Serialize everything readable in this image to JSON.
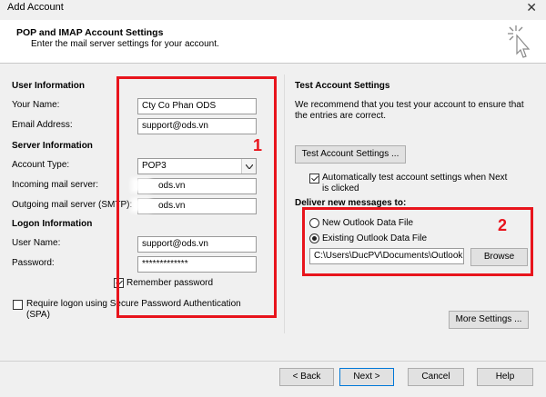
{
  "window": {
    "title": "Add Account",
    "close_glyph": "✕"
  },
  "header": {
    "title": "POP and IMAP Account Settings",
    "subtitle": "Enter the mail server settings for your account."
  },
  "user_info": {
    "section": "User Information",
    "your_name_label": "Your Name:",
    "your_name_value": "Cty Co Phan ODS",
    "email_label": "Email Address:",
    "email_value": "support@ods.vn"
  },
  "server_info": {
    "section": "Server Information",
    "account_type_label": "Account Type:",
    "account_type_value": "POP3",
    "incoming_label": "Incoming mail server:",
    "incoming_value": "ods.vn",
    "outgoing_label": "Outgoing mail server (SMTP):",
    "outgoing_value": "ods.vn"
  },
  "logon_info": {
    "section": "Logon Information",
    "username_label": "User Name:",
    "username_value": "support@ods.vn",
    "password_label": "Password:",
    "password_value": "*************",
    "remember_label": "Remember password",
    "remember_checked": true,
    "spa_label_line1": "Require logon using Secure Password Authentication",
    "spa_label_line2": "(SPA)",
    "spa_checked": false
  },
  "test": {
    "section": "Test Account Settings",
    "desc_line1": "We recommend that you test your account to ensure that",
    "desc_line2": "the entries are correct.",
    "button": "Test Account Settings ...",
    "auto_line1": "Automatically test account settings when Next",
    "auto_line2": "is clicked",
    "auto_checked": true
  },
  "deliver": {
    "section": "Deliver new messages to:",
    "option_new": "New Outlook Data File",
    "option_existing": "Existing Outlook Data File",
    "selected": "existing",
    "path_value": "C:\\Users\\DucPV\\Documents\\Outlook",
    "browse_button": "Browse"
  },
  "more_settings_button": "More Settings ...",
  "footer": {
    "back": "< Back",
    "next": "Next >",
    "cancel": "Cancel",
    "help": "Help"
  },
  "annotations": {
    "box1_number": "1",
    "box2_number": "2",
    "color": "#e8141c"
  },
  "icons": {
    "dropdown": "chevron-down-icon",
    "header": "cursor-click-icon"
  }
}
